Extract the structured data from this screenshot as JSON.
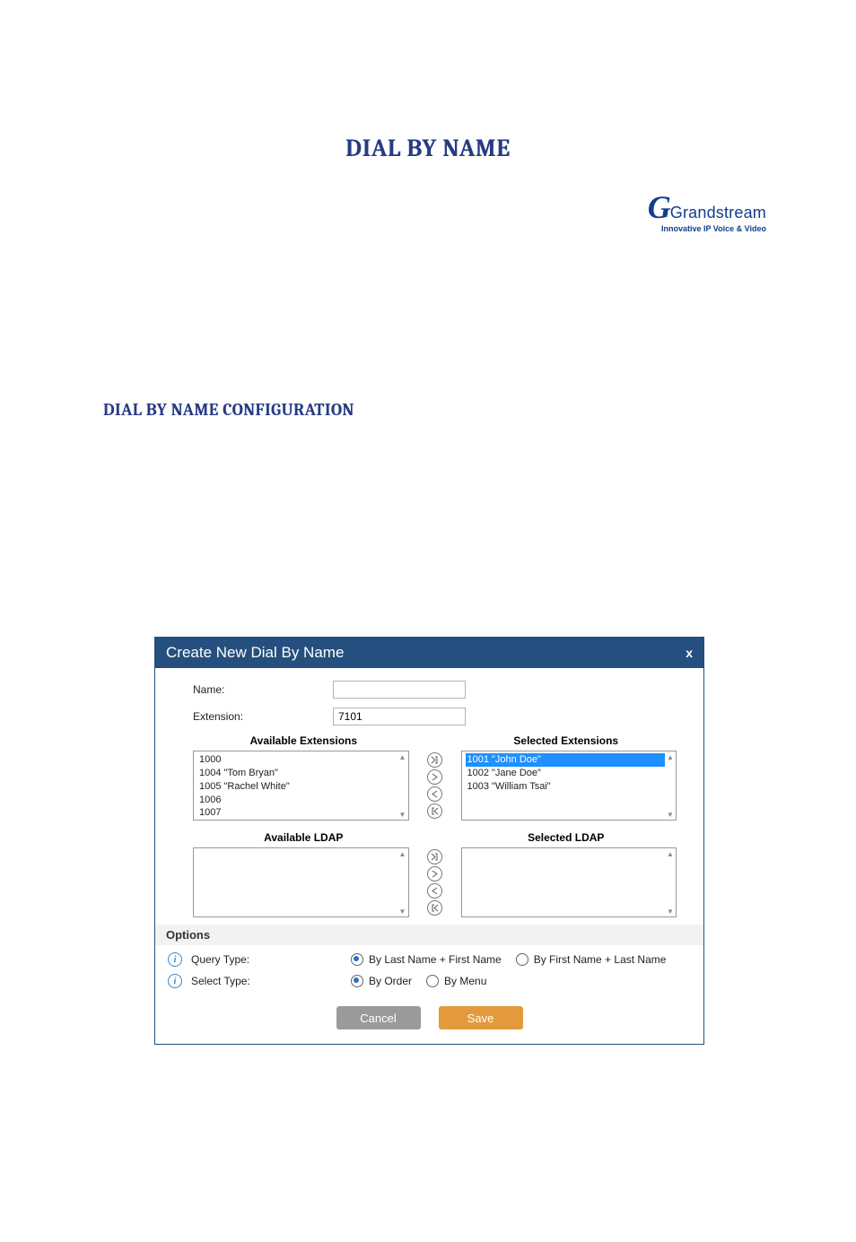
{
  "brand": {
    "name": "Grandstream",
    "tagline": "Innovative IP Voice & Video"
  },
  "page": {
    "title": "DIAL BY NAME",
    "section": "DIAL BY NAME CONFIGURATION"
  },
  "dialog": {
    "title": "Create New Dial By Name",
    "close_glyph": "x",
    "fields": {
      "name_label": "Name:",
      "name_value": "",
      "extension_label": "Extension:",
      "extension_value": "7101"
    },
    "extensions": {
      "available_heading": "Available Extensions",
      "selected_heading": "Selected Extensions",
      "available": [
        "1000",
        "1004 \"Tom Bryan\"",
        "1005 \"Rachel White\"",
        "1006",
        "1007"
      ],
      "selected": [
        "1001 \"John Doe\"",
        "1002 \"Jane Doe\"",
        "1003 \"William Tsai\""
      ],
      "selected_highlight_index": 0
    },
    "ldap": {
      "available_heading": "Available LDAP",
      "selected_heading": "Selected LDAP",
      "available": [],
      "selected": []
    },
    "options": {
      "heading": "Options",
      "query_type": {
        "label": "Query Type:",
        "options": [
          {
            "label": "By Last Name + First Name",
            "checked": true
          },
          {
            "label": "By First Name + Last Name",
            "checked": false
          }
        ]
      },
      "select_type": {
        "label": "Select Type:",
        "options": [
          {
            "label": "By Order",
            "checked": true
          },
          {
            "label": "By Menu",
            "checked": false
          }
        ]
      }
    },
    "buttons": {
      "cancel": "Cancel",
      "save": "Save"
    }
  },
  "icons": {
    "chevron_up": "▲",
    "chevron_down": "▼"
  }
}
